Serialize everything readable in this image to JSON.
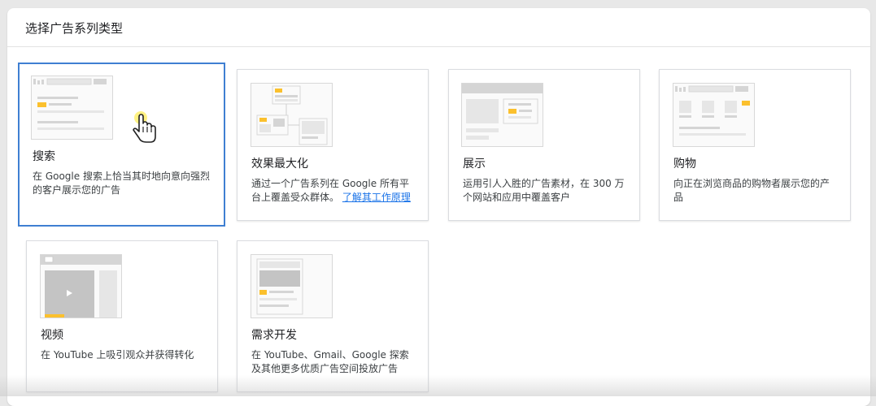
{
  "panel": {
    "title": "选择广告系列类型"
  },
  "cards": [
    {
      "title": "搜索",
      "desc": "在 Google 搜索上恰当其时地向意向强烈的客户展示您的广告",
      "selected": true
    },
    {
      "title": "效果最大化",
      "desc": "通过一个广告系列在 Google 所有平台上覆盖受众群体。",
      "link": "了解其工作原理"
    },
    {
      "title": "展示",
      "desc": "运用引人入胜的广告素材，在 300 万个网站和应用中覆盖客户"
    },
    {
      "title": "购物",
      "desc": "向正在浏览商品的购物者展示您的产品"
    },
    {
      "title": "视频",
      "desc": "在 YouTube 上吸引观众并获得转化"
    },
    {
      "title": "需求开发",
      "desc": "在 YouTube、Gmail、Google 探索及其他更多优质广告空间投放广告"
    }
  ],
  "icons": [
    "hand-cursor-icon",
    "play-icon"
  ],
  "colors": {
    "accent": "#fbc02d",
    "selected_border": "#3f7fd2",
    "link": "#1a73e8"
  }
}
